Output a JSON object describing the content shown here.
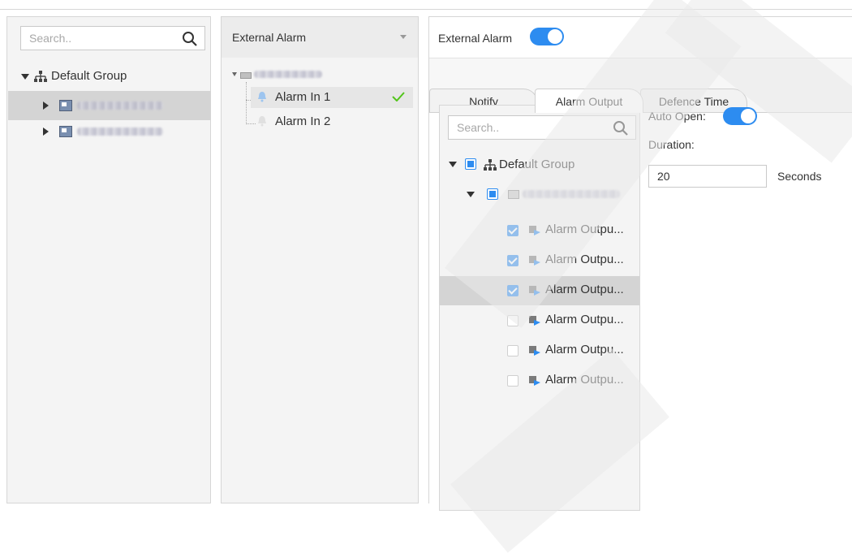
{
  "left_panel": {
    "search_placeholder": "Search..",
    "tree": {
      "root_label": "Default Group"
    }
  },
  "middle_panel": {
    "dropdown_value": "External Alarm",
    "alarm_inputs": [
      {
        "label": "Alarm In 1",
        "selected": true,
        "checked": true
      },
      {
        "label": "Alarm In 2",
        "selected": false,
        "checked": false
      }
    ]
  },
  "right_panel": {
    "header_label": "External Alarm",
    "header_toggle_on": true,
    "tabs": [
      "Notify",
      "Alarm Output",
      "Defence Time"
    ],
    "active_tab": "Alarm Output",
    "output_tree": {
      "search_placeholder": "Search..",
      "root_label": "Default Group",
      "outputs": [
        {
          "label": "Alarm Outpu...",
          "checked": true,
          "highlighted": false
        },
        {
          "label": "Alarm Outpu...",
          "checked": true,
          "highlighted": false
        },
        {
          "label": "Alarm Outpu...",
          "checked": true,
          "highlighted": true
        },
        {
          "label": "Alarm Outpu...",
          "checked": false,
          "highlighted": false
        },
        {
          "label": "Alarm Outpu...",
          "checked": false,
          "highlighted": false
        },
        {
          "label": "Alarm Outpu...",
          "checked": false,
          "highlighted": false
        }
      ]
    },
    "auto_open_label": "Auto Open:",
    "auto_open_on": true,
    "duration_label": "Duration:",
    "duration_value": "20",
    "duration_unit": "Seconds"
  },
  "colors": {
    "accent": "#2d8cf0",
    "check_green": "#52c41a",
    "selection_gray": "#d4d4d4",
    "panel_bg": "#f4f4f4"
  }
}
